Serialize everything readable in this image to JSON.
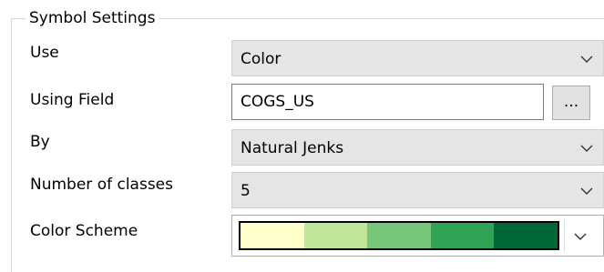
{
  "group": {
    "title": "Symbol Settings"
  },
  "rows": {
    "use": {
      "label": "Use",
      "value": "Color"
    },
    "using_field": {
      "label": "Using Field",
      "value": "COGS_US",
      "browse_label": "..."
    },
    "by": {
      "label": "By",
      "value": "Natural Jenks"
    },
    "num_classes": {
      "label": "Number of classes",
      "value": "5"
    },
    "color_scheme": {
      "label": "Color Scheme",
      "colors": [
        "#ffffcc",
        "#c2e699",
        "#78c679",
        "#31a354",
        "#006837"
      ]
    }
  },
  "icons": {
    "dropdown": "chevron-down-icon"
  }
}
